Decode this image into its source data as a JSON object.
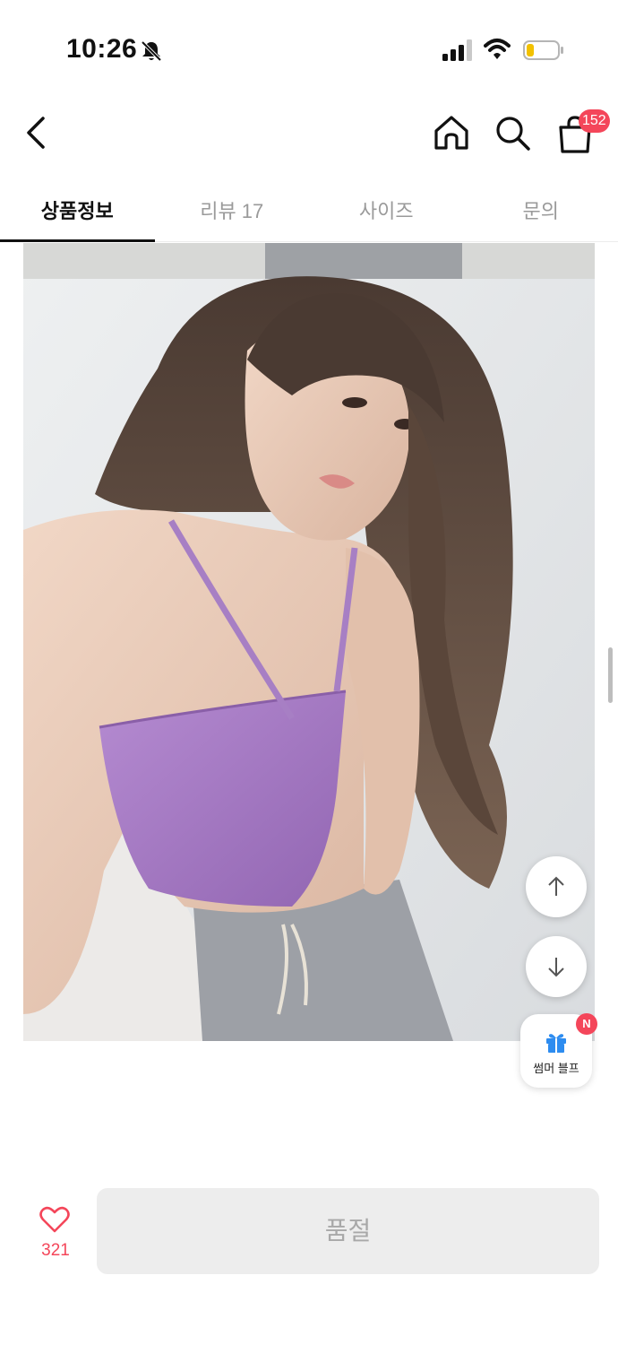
{
  "status_bar": {
    "time": "10:26"
  },
  "nav": {
    "cart_count": "152"
  },
  "tabs": [
    {
      "label": "상품정보",
      "active": true
    },
    {
      "label": "리뷰 17",
      "active": false
    },
    {
      "label": "사이즈",
      "active": false
    },
    {
      "label": "문의",
      "active": false
    }
  ],
  "product_image": {
    "description_colors": {
      "top": "#a77fc4",
      "background": "#e6e8ea"
    }
  },
  "floating": {
    "promo_label": "썸머 블프",
    "promo_badge": "N"
  },
  "bottom_bar": {
    "like_count": "321",
    "buy_button_label": "품절"
  },
  "colors": {
    "accent": "#f4465a",
    "disabled_bg": "#ededed",
    "disabled_text": "#a8a8a8"
  }
}
